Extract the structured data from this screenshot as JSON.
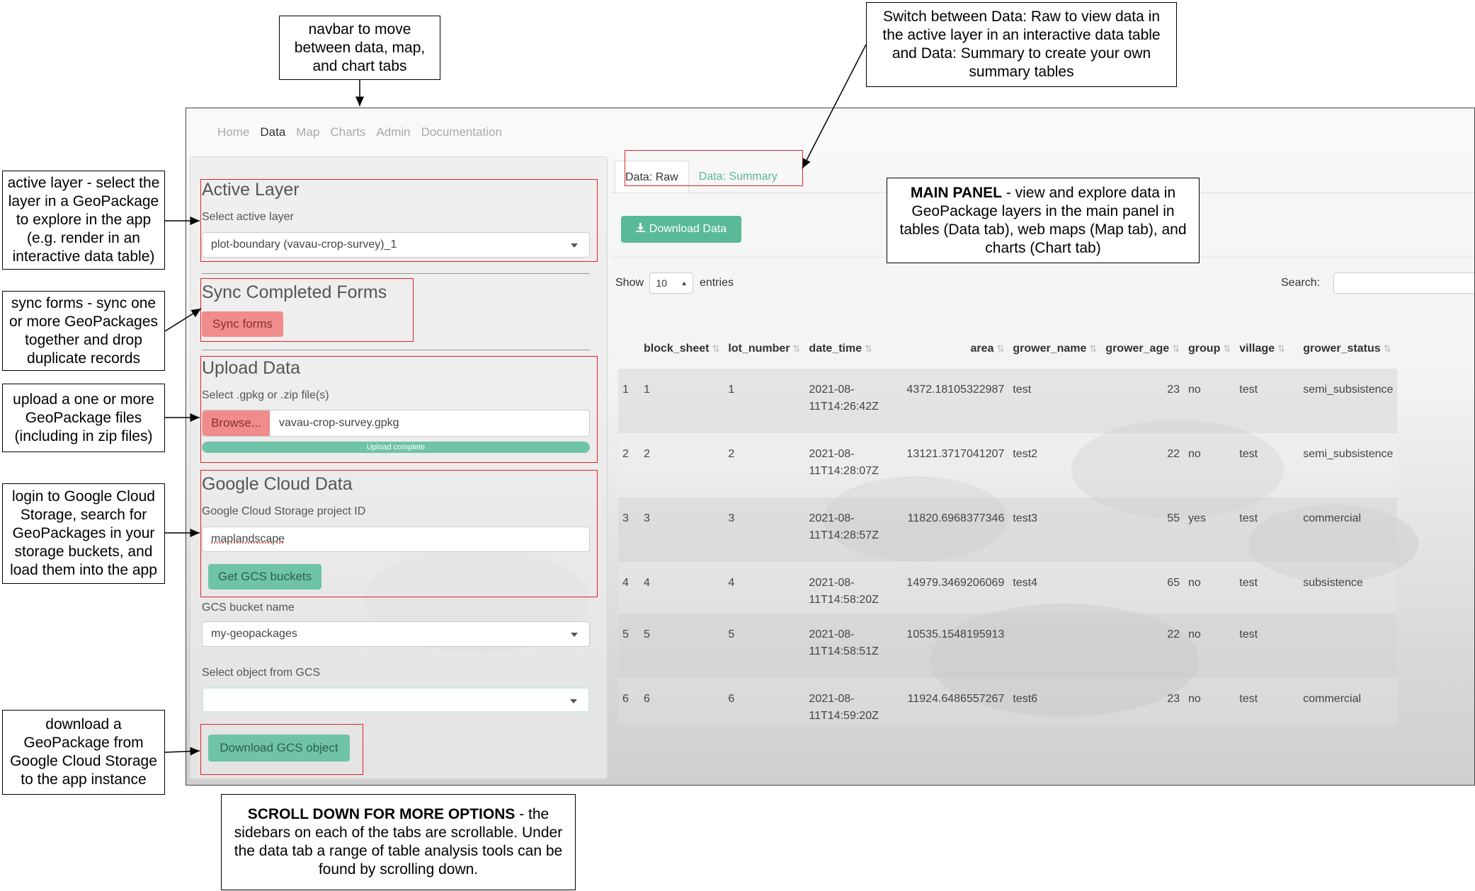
{
  "annotations": {
    "navbar": "navbar to move between data, map, and chart tabs",
    "switch_tabs": "Switch between Data: Raw to view data in the active layer in an interactive data table and Data: Summary to create your own summary tables",
    "active_layer": "active layer - select the layer in a GeoPackage to explore in the app (e.g. render in an interactive data table)",
    "sync_forms": "sync forms - sync one or more GeoPackages together and drop duplicate records",
    "upload": "upload a one or more GeoPackage files (including  in zip files)",
    "gcs_login": "login to Google Cloud Storage, search for GeoPackages in your storage buckets, and load them into the app",
    "download_gcs": "download a GeoPackage from Google Cloud Storage to the app instance",
    "main_panel_bold": "MAIN PANEL",
    "main_panel_rest": " - view and explore data in GeoPackage layers in the main panel in tables (Data tab), web maps (Map tab), and charts (Chart tab)",
    "scroll_bold": "SCROLL DOWN FOR MORE OPTIONS",
    "scroll_rest": " - the sidebars on each of the tabs are scrollable. Under the data tab a range of table analysis tools can be found by scrolling down."
  },
  "navbar": {
    "items": [
      "Home",
      "Data",
      "Map",
      "Charts",
      "Admin",
      "Documentation"
    ],
    "active": "Data"
  },
  "sidebar": {
    "active_layer": {
      "title": "Active Layer",
      "label": "Select active layer",
      "value": "plot-boundary (vavau-crop-survey)_1"
    },
    "sync": {
      "title": "Sync Completed Forms",
      "button": "Sync forms"
    },
    "upload": {
      "title": "Upload Data",
      "label": "Select .gpkg or .zip file(s)",
      "browse_button": "Browse...",
      "file_name": "vavau-crop-survey.gpkg",
      "progress_text": "Upload complete",
      "progress": 1.0
    },
    "gcs": {
      "title": "Google Cloud Data",
      "project_label": "Google Cloud Storage project ID",
      "project_value": "maplandscape",
      "get_buckets_button": "Get GCS buckets",
      "bucket_label": "GCS bucket name",
      "bucket_value": "my-geopackages",
      "object_label": "Select object from GCS",
      "object_value": "",
      "download_button": "Download GCS object"
    }
  },
  "main": {
    "tabs": [
      {
        "label": "Data: Raw",
        "active": true
      },
      {
        "label": "Data: Summary",
        "active": false
      }
    ],
    "download_button": "Download Data",
    "show_label": "Show",
    "entries_value": "10",
    "entries_label": "entries",
    "search_label": "Search:",
    "search_value": "",
    "columns": [
      "",
      "block_sheet",
      "lot_number",
      "date_time",
      "area",
      "grower_name",
      "grower_age",
      "group",
      "village",
      "grower_status"
    ],
    "rows": [
      [
        "1",
        "1",
        "1",
        "2021-08-\n11T14:26:42Z",
        "4372.18105322987",
        "test",
        "23",
        "no",
        "test",
        "semi_subsistence"
      ],
      [
        "2",
        "2",
        "2",
        "2021-08-\n11T14:28:07Z",
        "13121.3717041207",
        "test2",
        "22",
        "no",
        "test",
        "semi_subsistence"
      ],
      [
        "3",
        "3",
        "3",
        "2021-08-\n11T14:28:57Z",
        "11820.6968377346",
        "test3",
        "55",
        "yes",
        "test",
        "commercial"
      ],
      [
        "4",
        "4",
        "4",
        "2021-08-\n11T14:58:20Z",
        "14979.3469206069",
        "test4",
        "65",
        "no",
        "test",
        "subsistence"
      ],
      [
        "5",
        "5",
        "5",
        "2021-08-\n11T14:58:51Z",
        "10535.1548195913",
        "",
        "22",
        "no",
        "test",
        ""
      ],
      [
        "6",
        "6",
        "6",
        "2021-08-\n11T14:59:20Z",
        "11924.6486557267",
        "test6",
        "23",
        "no",
        "test",
        "commercial"
      ]
    ]
  },
  "colors": {
    "annotation_box": "#e32222",
    "teal_button": "#58ba96",
    "red_button": "#f08c8c"
  }
}
